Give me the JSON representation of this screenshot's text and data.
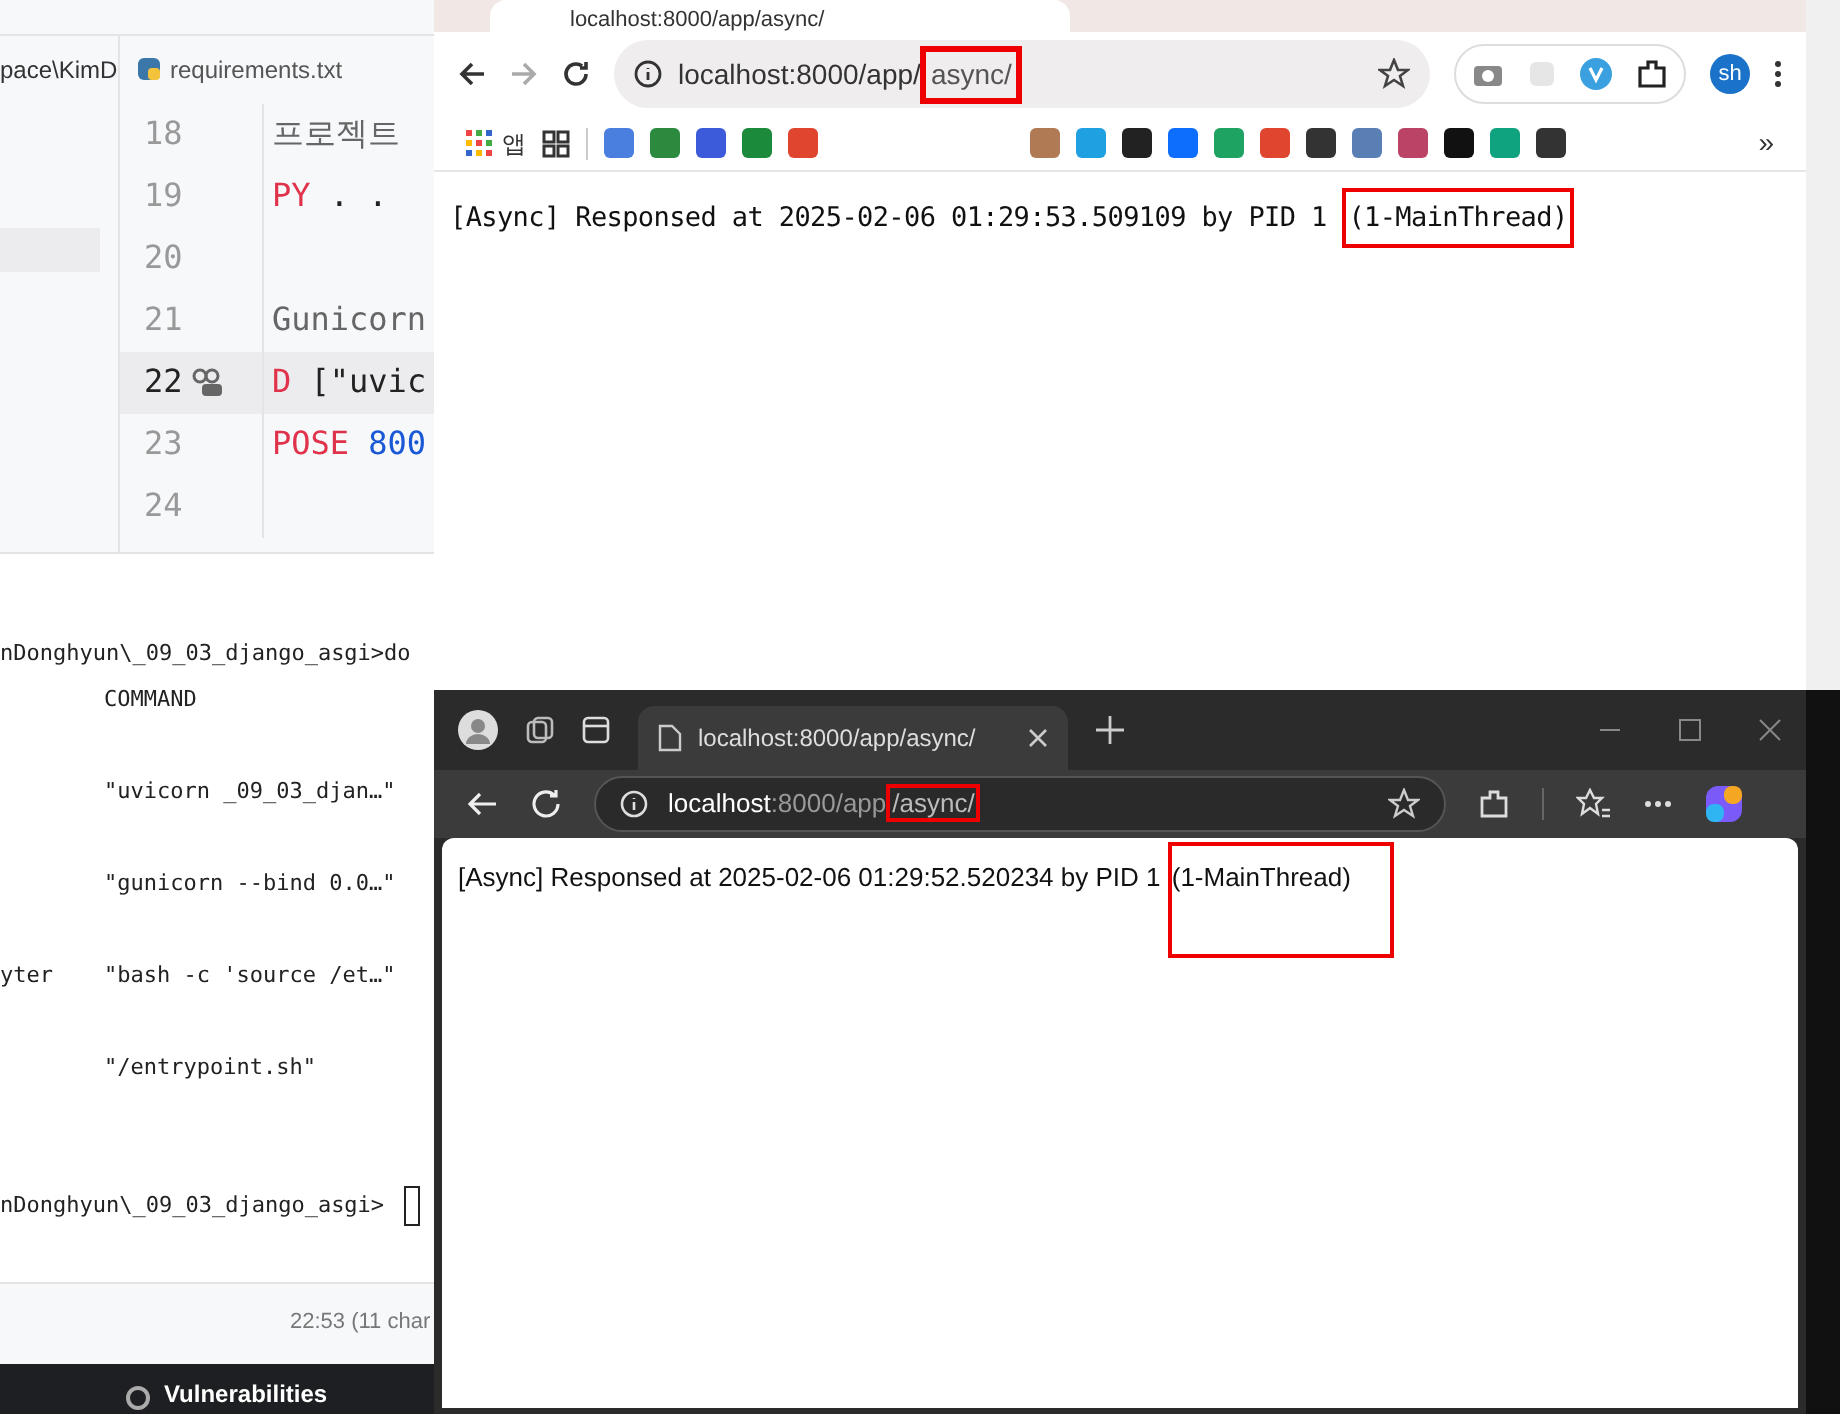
{
  "ide": {
    "path_fragment": "pace\\KimD",
    "editor_tab": "requirements.txt",
    "code_lines": [
      {
        "number": "18",
        "current": false,
        "tokens": [
          {
            "text": "프로젝트",
            "kind": "comment"
          }
        ]
      },
      {
        "number": "19",
        "current": false,
        "tokens": [
          {
            "text": "PY",
            "kind": "keyword"
          },
          {
            "text": " . .",
            "kind": "plain"
          }
        ]
      },
      {
        "number": "20",
        "current": false
      },
      {
        "number": "21",
        "current": false,
        "tokens": [
          {
            "text": "Gunicorn",
            "kind": "comment"
          }
        ]
      },
      {
        "number": "22",
        "current": true,
        "tokens": [
          {
            "text": "D",
            "kind": "keyword"
          },
          {
            "text": " [\"uvic",
            "kind": "plain"
          }
        ]
      },
      {
        "number": "23",
        "current": false,
        "tokens": [
          {
            "text": "POSE",
            "kind": "keyword"
          },
          {
            "text": " 800",
            "kind": "number"
          }
        ]
      },
      {
        "number": "24",
        "current": false
      }
    ],
    "terminal_lines": [
      {
        "left": "nDonghyun\\_09_03_django_asgi>do"
      },
      {
        "right": "COMMAND"
      },
      {
        "right": "\"uvicorn _09_03_djan…\""
      },
      {
        "right": "\"gunicorn --bind 0.0…\""
      },
      {
        "left": "yter",
        "right": "\"bash -c 'source /et…\""
      },
      {
        "right": "\"/entrypoint.sh\""
      },
      {
        "left": "nDonghyun\\_09_03_django_asgi>"
      }
    ],
    "status": "22:53 (11 char",
    "bottom_tool": "Vulnerabilities"
  },
  "chrome": {
    "tab_title": "localhost:8000/app/async/",
    "url": "localhost:8000/app/",
    "url_highlighted": "async/",
    "profile": "sh",
    "apps_label": "앱",
    "more": "»",
    "content": "[Async] Responsed at 2025-02-06 01:29:53.509109 by PID 1 ",
    "content_highlighted": "(1-MainThread)"
  },
  "edge": {
    "tab_title": "localhost:8000/app/async/",
    "url_host": "localhost",
    "url_path": ":8000/app",
    "url_highlighted": "/async/",
    "content": "[Async] Responsed at 2025-02-06 01:29:52.520234 by PID 1 ",
    "content_highlighted": "(1-MainThread)"
  }
}
